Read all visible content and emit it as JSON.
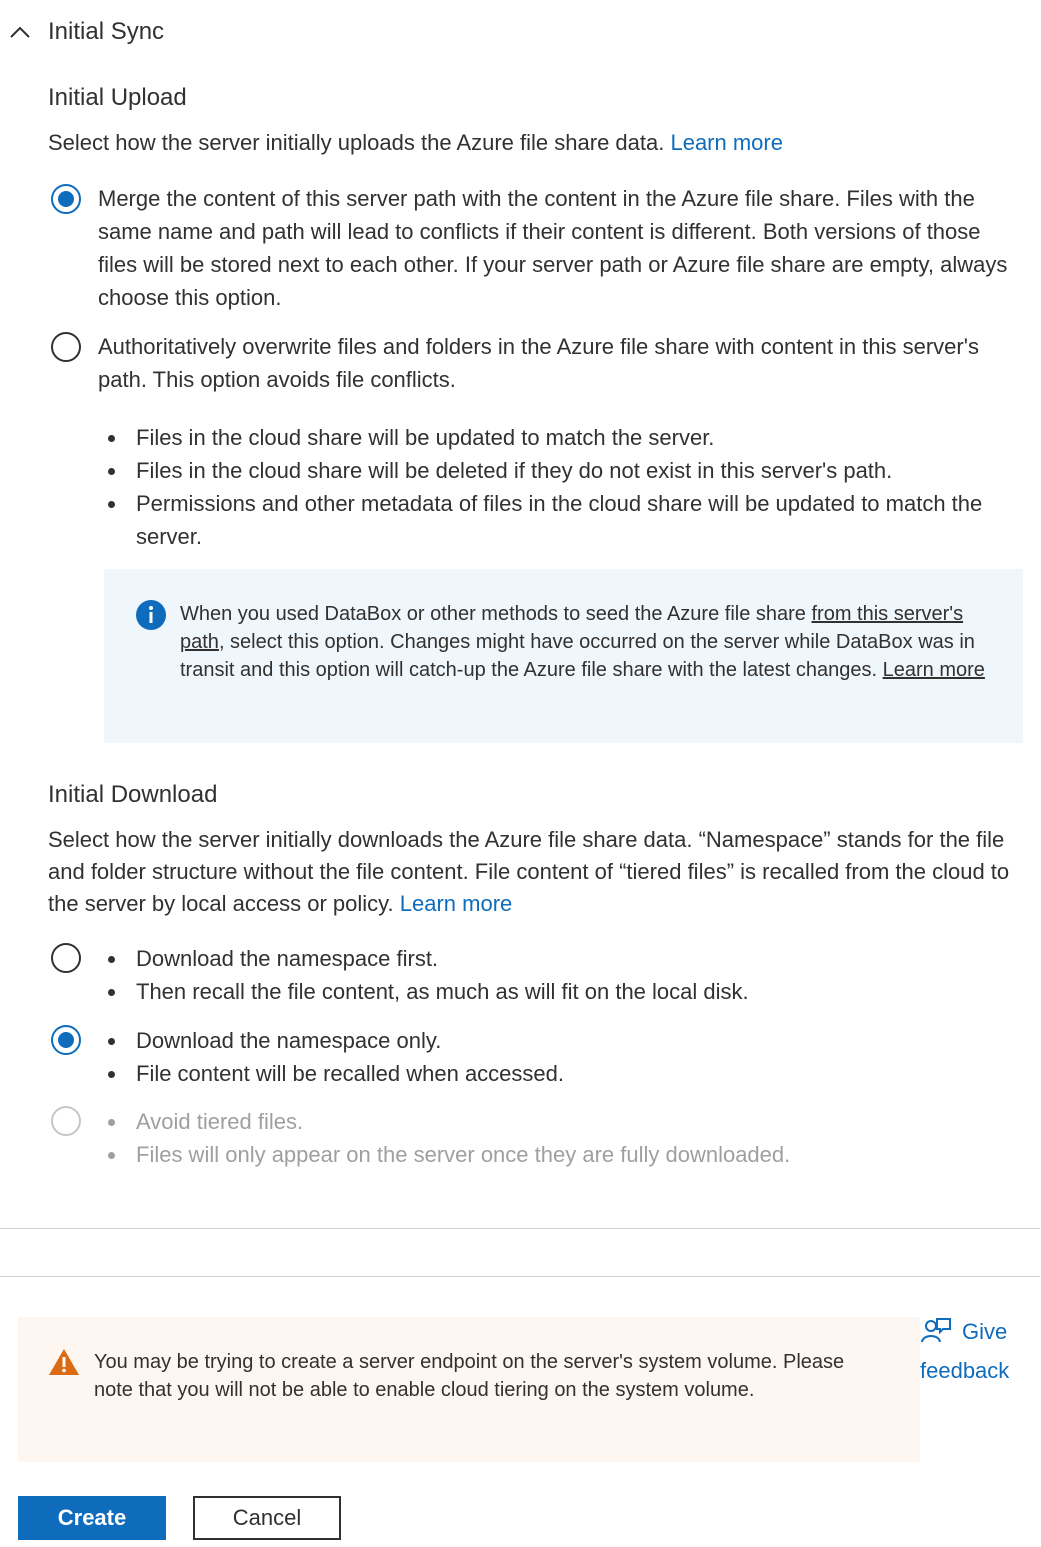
{
  "section": {
    "title": "Initial Sync",
    "icon": "chevron-up-icon"
  },
  "upload": {
    "heading": "Initial Upload",
    "description": "Select how the server initially uploads the Azure file share data.",
    "learn_more": "Learn more",
    "options": [
      {
        "text": "Merge the content of this server path with the content in the Azure file share. Files with the same name and path will lead to conflicts if their content is different. Both versions of those files will be stored next to each other. If your server path or Azure file share are empty, always choose this option.",
        "selected": true
      },
      {
        "text": "Authoritatively overwrite files and folders in the Azure file share with content in this server's path. This option avoids file conflicts.",
        "selected": false
      }
    ],
    "overwrite_bullets": [
      "Files in the cloud share will be updated to match the server.",
      "Files in the cloud share will be deleted if they do not exist in this server's path.",
      "Permissions and other metadata of files in the cloud share will be updated to match the server."
    ],
    "info": {
      "icon": "info-icon",
      "text_before": "When you used DataBox or other methods to seed the Azure file share ",
      "underlined": "from this server's path",
      "text_after": ", select this option. Changes might have occurred on the server while DataBox was in transit and this option will catch-up the Azure file share with the latest changes. ",
      "learn_more": "Learn more"
    }
  },
  "download": {
    "heading": "Initial Download",
    "description": "Select how the server initially downloads the Azure file share data. “Namespace” stands for the file and folder structure without the file content. File content of “tiered files” is recalled from the cloud to the server by local access or policy.",
    "learn_more": "Learn more",
    "options": [
      {
        "bullets": [
          "Download the namespace first.",
          "Then recall the file content, as much as will fit on the local disk."
        ],
        "selected": false,
        "disabled": false
      },
      {
        "bullets": [
          "Download the namespace only.",
          "File content will be recalled when accessed."
        ],
        "selected": true,
        "disabled": false
      },
      {
        "bullets": [
          "Avoid tiered files.",
          "Files will only appear on the server once they are fully downloaded."
        ],
        "selected": false,
        "disabled": true
      }
    ]
  },
  "warning": {
    "icon": "warning-icon",
    "text": "You may be trying to create a server endpoint on the server's system volume. Please note that you will not be able to enable cloud tiering on the system volume."
  },
  "feedback": {
    "icon": "feedback-icon",
    "label": "Give feedback"
  },
  "actions": {
    "create": "Create",
    "cancel": "Cancel"
  },
  "colors": {
    "accent": "#0f6cbd",
    "info_bg": "#eff6fc",
    "warning_bg": "#fdf6f1",
    "warning_icon": "#da6a13"
  }
}
